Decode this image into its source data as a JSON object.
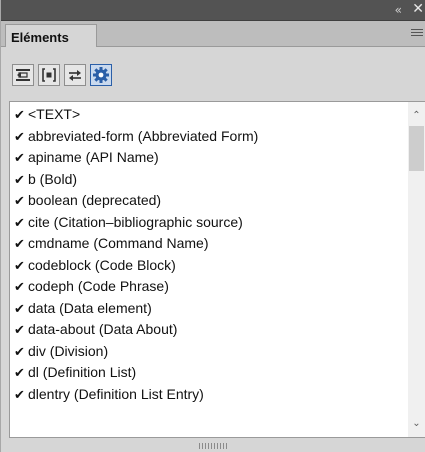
{
  "panel": {
    "collapse_icon": "«",
    "close_icon": "✕",
    "tab_label": "Eléments"
  },
  "toolbar": {
    "buttons": [
      {
        "icon": "insert-element-icon"
      },
      {
        "icon": "wrap-element-icon"
      },
      {
        "icon": "change-element-icon"
      },
      {
        "icon": "settings-gear-icon",
        "active": true
      }
    ]
  },
  "elements": [
    {
      "check": "✔",
      "label": "<TEXT>"
    },
    {
      "check": "✔",
      "label": "abbreviated-form  (Abbreviated Form)"
    },
    {
      "check": "✔",
      "label": "apiname  (API Name)"
    },
    {
      "check": "✔",
      "label": "b  (Bold)"
    },
    {
      "check": "✔",
      "label": "boolean  (deprecated)"
    },
    {
      "check": "✔",
      "label": "cite  (Citation–bibliographic source)"
    },
    {
      "check": "✔",
      "label": "cmdname  (Command Name)"
    },
    {
      "check": "✔",
      "label": "codeblock  (Code Block)"
    },
    {
      "check": "✔",
      "label": "codeph  (Code Phrase)"
    },
    {
      "check": "✔",
      "label": "data  (Data element)"
    },
    {
      "check": "✔",
      "label": "data-about  (Data About)"
    },
    {
      "check": "✔",
      "label": "div  (Division)"
    },
    {
      "check": "✔",
      "label": "dl  (Definition List)"
    },
    {
      "check": "✔",
      "label": "dlentry  (Definition List Entry)"
    }
  ],
  "scrollbar": {
    "up_arrow": "⌃",
    "down_arrow": "⌄"
  },
  "colors": {
    "titlebar": "#535353",
    "panel_bg": "#d6d6d6",
    "active_button": "#2b5fa8"
  }
}
